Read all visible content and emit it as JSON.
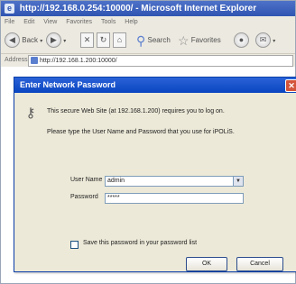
{
  "window": {
    "title": "http://192.168.0.254:10000/ - Microsoft Internet Explorer"
  },
  "menu": {
    "items": [
      "File",
      "Edit",
      "View",
      "Favorites",
      "Tools",
      "Help"
    ]
  },
  "toolbar": {
    "back_label": "Back",
    "search_label": "Search",
    "favorites_label": "Favorites"
  },
  "address": {
    "label": "Address",
    "url": "http://192.168.1.200:10000/"
  },
  "dialog": {
    "title": "Enter Network Password",
    "message_line1": "This secure Web Site (at 192.168.1.200) requires you to log on.",
    "message_line2": "Please type the User Name and Password that you use for iPOLiS.",
    "username_label": "User Name",
    "username_value": "admin",
    "password_label": "Password",
    "password_value": "*****",
    "save_password_label": "Save this password in your password list",
    "save_password_checked": false,
    "ok_label": "OK",
    "cancel_label": "Cancel"
  },
  "icons": {
    "title": "ie-icon",
    "back": "back-arrow-icon",
    "forward": "forward-arrow-icon",
    "stop": "stop-icon",
    "refresh": "refresh-icon",
    "home": "home-icon",
    "search": "search-icon",
    "favorites": "star-icon",
    "media": "media-icon",
    "mail": "mail-icon",
    "address": "page-icon",
    "key": "key-icon",
    "close": "close-icon",
    "dropdown": "chevron-down-icon"
  }
}
